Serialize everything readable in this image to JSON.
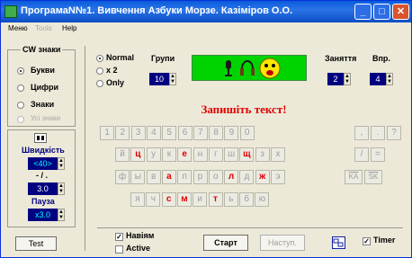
{
  "window": {
    "title": "ПрограмаN№1. Вивчення Азбуки Морзе. Казіміров О.О.",
    "controls": {
      "minimize": "_",
      "maximize": "□",
      "close": "✕"
    }
  },
  "menu": [
    {
      "label": "Меню",
      "disabled": false
    },
    {
      "label": "Tools",
      "disabled": true
    },
    {
      "label": "Help",
      "disabled": false
    }
  ],
  "cw_group": {
    "title": "CW знаки",
    "options": [
      {
        "label": "Букви",
        "selected": true,
        "disabled": false
      },
      {
        "label": "Цифри",
        "selected": false,
        "disabled": false
      },
      {
        "label": "Знаки",
        "selected": false,
        "disabled": false
      },
      {
        "label": "Усі знаки",
        "selected": false,
        "disabled": true
      }
    ]
  },
  "speed": {
    "icon": "grid-icon",
    "label": "Швидкість",
    "value": "<40>",
    "ratio_label": "- / .",
    "ratio_value": "3.0",
    "pause_label": "Пауза",
    "pause_value": "x3.0"
  },
  "test_button": "Test",
  "mode": {
    "options": [
      {
        "label": "Normal",
        "selected": true
      },
      {
        "label": "x 2",
        "selected": false
      },
      {
        "label": "Only",
        "selected": false
      }
    ]
  },
  "groups": {
    "label": "Групи",
    "value": "10"
  },
  "lessons": {
    "label": "Заняття",
    "value": "2"
  },
  "exercise": {
    "label": "Впр.",
    "value": "4"
  },
  "banner_icons": [
    "microphone-icon",
    "headphones-icon",
    "face-icon"
  ],
  "heading": "Запишіть текст!",
  "keyboard": {
    "rows": [
      [
        {
          "c": "1"
        },
        {
          "c": "2"
        },
        {
          "c": "3"
        },
        {
          "c": "4"
        },
        {
          "c": "5"
        },
        {
          "c": "6"
        },
        {
          "c": "7"
        },
        {
          "c": "8"
        },
        {
          "c": "9"
        },
        {
          "c": "0"
        }
      ],
      [
        {
          "c": "й"
        },
        {
          "c": "ц",
          "red": true
        },
        {
          "c": "у"
        },
        {
          "c": "к"
        },
        {
          "c": "е",
          "red": true
        },
        {
          "c": "н"
        },
        {
          "c": "г"
        },
        {
          "c": "ш"
        },
        {
          "c": "щ",
          "red": true
        },
        {
          "c": "з"
        },
        {
          "c": "х"
        }
      ],
      [
        {
          "c": "ф"
        },
        {
          "c": "ы"
        },
        {
          "c": "в"
        },
        {
          "c": "а",
          "red": true
        },
        {
          "c": "п"
        },
        {
          "c": "р"
        },
        {
          "c": "о"
        },
        {
          "c": "л",
          "red": true
        },
        {
          "c": "д"
        },
        {
          "c": "ж",
          "red": true
        },
        {
          "c": "э"
        }
      ],
      [
        {
          "c": "я"
        },
        {
          "c": "ч"
        },
        {
          "c": "с",
          "red": true
        },
        {
          "c": "м",
          "red": true
        },
        {
          "c": "и"
        },
        {
          "c": "т",
          "red": true
        },
        {
          "c": "ь"
        },
        {
          "c": "б"
        },
        {
          "c": "ю"
        }
      ]
    ],
    "right_keys": [
      [
        {
          "c": ","
        },
        {
          "c": "."
        },
        {
          "c": "?"
        }
      ],
      [
        {
          "c": "/"
        },
        {
          "c": "="
        }
      ],
      [
        {
          "c": "KA"
        },
        {
          "c": "SK"
        }
      ]
    ]
  },
  "bottom": {
    "hints_label": "Навіям",
    "hints_checked": true,
    "active_label": "Active",
    "active_checked": false,
    "start_button": "Старт",
    "next_button": "Наступ.",
    "timer_label": "Timer",
    "timer_checked": true,
    "icon": "keyboard-icon"
  }
}
